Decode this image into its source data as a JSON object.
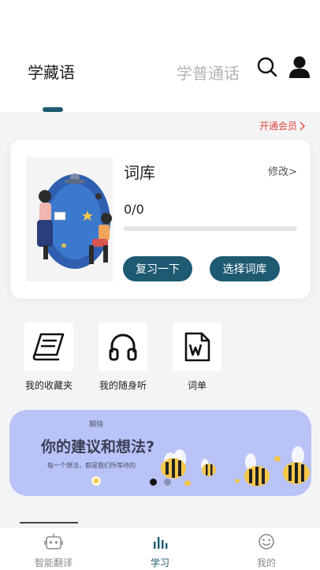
{
  "header": {
    "tabs": [
      {
        "label": "学藏语",
        "active": true
      },
      {
        "label": "学普通话",
        "active": false
      }
    ],
    "icons": [
      "search-icon",
      "user-icon"
    ]
  },
  "vip": {
    "label": "开通会员"
  },
  "vocab_card": {
    "title": "词库",
    "modify_label": "修改>",
    "progress_text": "0/0",
    "progress_fraction": 0,
    "review_button": "复习一下",
    "select_button": "选择词库"
  },
  "shortcuts": [
    {
      "label": "我的收藏夹",
      "icon": "book-icon"
    },
    {
      "label": "我的随身听",
      "icon": "headphones-icon"
    },
    {
      "label": "词单",
      "icon": "word-document-icon"
    }
  ],
  "banner": {
    "small_text": "期待",
    "title": "你的建议和想法?",
    "subtitle": "每一个想法，都是我们所等待的",
    "active_dot": 0,
    "dot_count": 2
  },
  "bottom_nav": [
    {
      "label": "智能翻译",
      "icon": "robot-icon",
      "active": false
    },
    {
      "label": "学习",
      "icon": "bar-chart-icon",
      "active": true
    },
    {
      "label": "我的",
      "icon": "smiley-icon",
      "active": false
    }
  ],
  "colors": {
    "accent": "#1e5a72",
    "vip_red": "#e0473d",
    "banner_bg": "#b9c3f7",
    "page_bg": "#f3f4f6"
  }
}
